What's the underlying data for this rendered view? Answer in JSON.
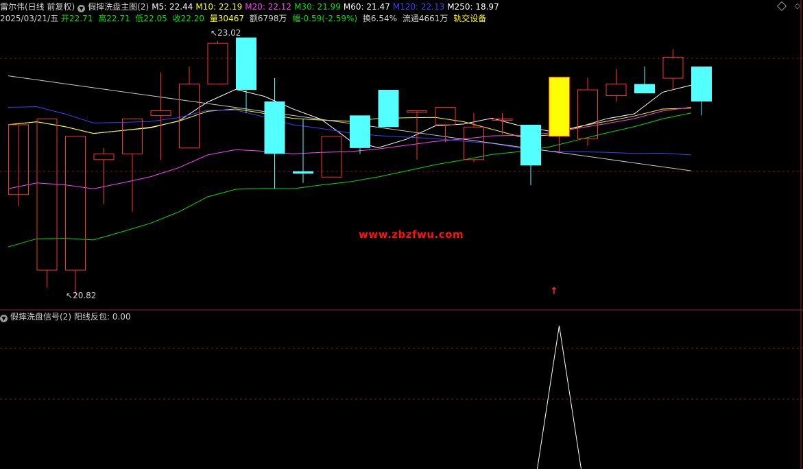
{
  "header": {
    "stock": "雷尔伟(日线 前复权)",
    "main_indicator": "假摔洗盘主图(2)",
    "ma": [
      {
        "label": "M5: 22.44",
        "color": "#ffffff"
      },
      {
        "label": "M10: 22.19",
        "color": "#ffff00"
      },
      {
        "label": "M20: 22.12",
        "color": "#ff40ff"
      },
      {
        "label": "M30: 21.99",
        "color": "#00e000"
      },
      {
        "label": "M60: 21.47",
        "color": "#ffffff"
      },
      {
        "label": "M120: 22.13",
        "color": "#4040ff"
      },
      {
        "label": "M250: 18.97",
        "color": "#ffffff"
      }
    ],
    "quote": {
      "date": "2025/03/21/五",
      "open": "开22.71",
      "high": "高22.71",
      "low": "低22.05",
      "close": "收22.20",
      "volume": "量30467",
      "amount": "额6798万",
      "change": "幅-0.59(-2.59%)",
      "turnover": "换6.54%",
      "float": "流通4661万",
      "sector": "轨交设备"
    }
  },
  "sub_panel": {
    "title": "假摔洗盘信号(2)",
    "value_label": "阳线反包: 0.00"
  },
  "watermark": "www.zbzfwu.com",
  "chart_data": {
    "type": "candlestick",
    "high_label": "23.02",
    "low_label": "20.82",
    "candles": [
      {
        "o": 21.7,
        "h": 21.7,
        "l": 21.6,
        "c": 22.3
      },
      {
        "o": 21.05,
        "h": 22.35,
        "l": 20.9,
        "c": 22.35
      },
      {
        "o": 21.05,
        "h": 22.2,
        "l": 20.82,
        "c": 22.2
      },
      {
        "o": 22.0,
        "h": 22.1,
        "l": 21.62,
        "c": 22.05
      },
      {
        "o": 22.05,
        "h": 22.35,
        "l": 21.55,
        "c": 22.35
      },
      {
        "o": 22.38,
        "h": 22.75,
        "l": 22.0,
        "c": 22.42
      },
      {
        "o": 22.1,
        "h": 22.8,
        "l": 22.1,
        "c": 22.65
      },
      {
        "o": 22.65,
        "h": 23.02,
        "l": 22.65,
        "c": 23.0
      },
      {
        "o": 23.05,
        "h": 23.05,
        "l": 22.4,
        "c": 22.6
      },
      {
        "o": 22.5,
        "h": 22.7,
        "l": 21.75,
        "c": 22.05
      },
      {
        "o": 21.9,
        "h": 22.35,
        "l": 21.8,
        "c": 21.88
      },
      {
        "o": 21.85,
        "h": 22.2,
        "l": 21.85,
        "c": 22.2
      },
      {
        "o": 22.38,
        "h": 22.38,
        "l": 22.05,
        "c": 22.1
      },
      {
        "o": 22.6,
        "h": 22.6,
        "l": 22.28,
        "c": 22.28
      },
      {
        "o": 22.42,
        "h": 22.42,
        "l": 22.0,
        "c": 22.42
      },
      {
        "o": 22.3,
        "h": 22.45,
        "l": 22.15,
        "c": 22.45
      },
      {
        "o": 22.0,
        "h": 22.4,
        "l": 21.98,
        "c": 22.28
      },
      {
        "o": 22.35,
        "h": 22.4,
        "l": 22.22,
        "c": 22.35
      },
      {
        "o": 22.3,
        "h": 22.3,
        "l": 21.78,
        "c": 21.95
      },
      {
        "o": 22.71,
        "h": 22.71,
        "l": 22.05,
        "c": 22.2
      },
      {
        "o": 22.18,
        "h": 22.7,
        "l": 22.12,
        "c": 22.6
      },
      {
        "o": 22.55,
        "h": 22.78,
        "l": 22.5,
        "c": 22.65
      },
      {
        "o": 22.65,
        "h": 22.8,
        "l": 22.57,
        "c": 22.57
      },
      {
        "o": 22.7,
        "h": 22.95,
        "l": 22.6,
        "c": 22.88
      },
      {
        "o": 22.8,
        "h": 22.8,
        "l": 22.38,
        "c": 22.5
      }
    ],
    "signal": {
      "index": 19,
      "value": 1
    }
  },
  "colors": {
    "up": "#ff3030",
    "down": "#54ffff",
    "signal_candle": "#ffff00"
  }
}
